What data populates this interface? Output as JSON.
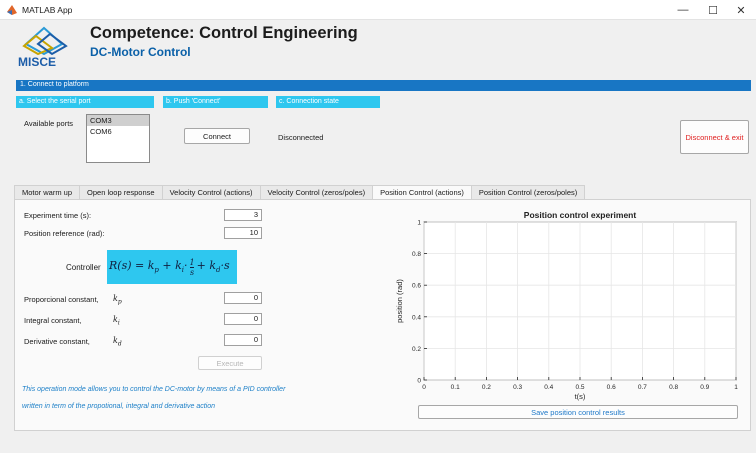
{
  "window": {
    "title": "MATLAB App"
  },
  "header": {
    "logo_text": "MISCE",
    "title": "Competence: Control Engineering",
    "subtitle": "DC-Motor Control"
  },
  "section": {
    "title": "1. Connect to platform"
  },
  "steps": [
    "a. Select the serial port",
    "b. Push 'Connect'",
    "c. Connection state"
  ],
  "ports": {
    "label": "Available ports",
    "options": [
      "COM3",
      "COM6"
    ],
    "selected": "COM3"
  },
  "connect": {
    "label": "Connect"
  },
  "connection_state": "Disconnected",
  "disconnect": {
    "label": "Disconnect & exit"
  },
  "tabs": [
    "Motor warm up",
    "Open loop response",
    "Velocity Control (actions)",
    "Velocity Control (zeros/poles)",
    "Position Control (actions)",
    "Position Control (zeros/poles)"
  ],
  "active_tab": "Position Control (actions)",
  "form": {
    "experiment_time": {
      "label": "Experiment time (s):",
      "value": "3"
    },
    "position_reference": {
      "label": "Position reference (rad):",
      "value": "10"
    },
    "controller_label": "Controller",
    "proportional": {
      "label": "Proporcional constant,",
      "symbol": "kp",
      "value": "0"
    },
    "integral": {
      "label": "Integral constant,",
      "symbol": "ki",
      "value": "0"
    },
    "derivative": {
      "label": "Derivative constant,",
      "symbol": "kd",
      "value": "0"
    },
    "execute_label": "Execute"
  },
  "info": {
    "line1": "This operation mode allows you to control the DC-motor by means of a PID controller",
    "line2": "written in term of the propotional, integral and derivative action"
  },
  "save": {
    "label": "Save position control results"
  },
  "colors": {
    "section_bar": "#1876c4",
    "step_bar": "#2ec7ef",
    "subtitle": "#0a60a8",
    "disconnect_text": "#e02020",
    "info_text": "#1e80c8"
  },
  "chart_data": {
    "type": "line",
    "title": "Position control experiment",
    "xlabel": "t(s)",
    "ylabel": "position (rad)",
    "xlim": [
      0,
      1
    ],
    "ylim": [
      0,
      1
    ],
    "xticks": [
      "0",
      "0.1",
      "0.2",
      "0.3",
      "0.4",
      "0.5",
      "0.6",
      "0.7",
      "0.8",
      "0.9",
      "1"
    ],
    "yticks": [
      "0",
      "0.2",
      "0.4",
      "0.6",
      "0.8",
      "1"
    ],
    "grid": true,
    "series": []
  }
}
